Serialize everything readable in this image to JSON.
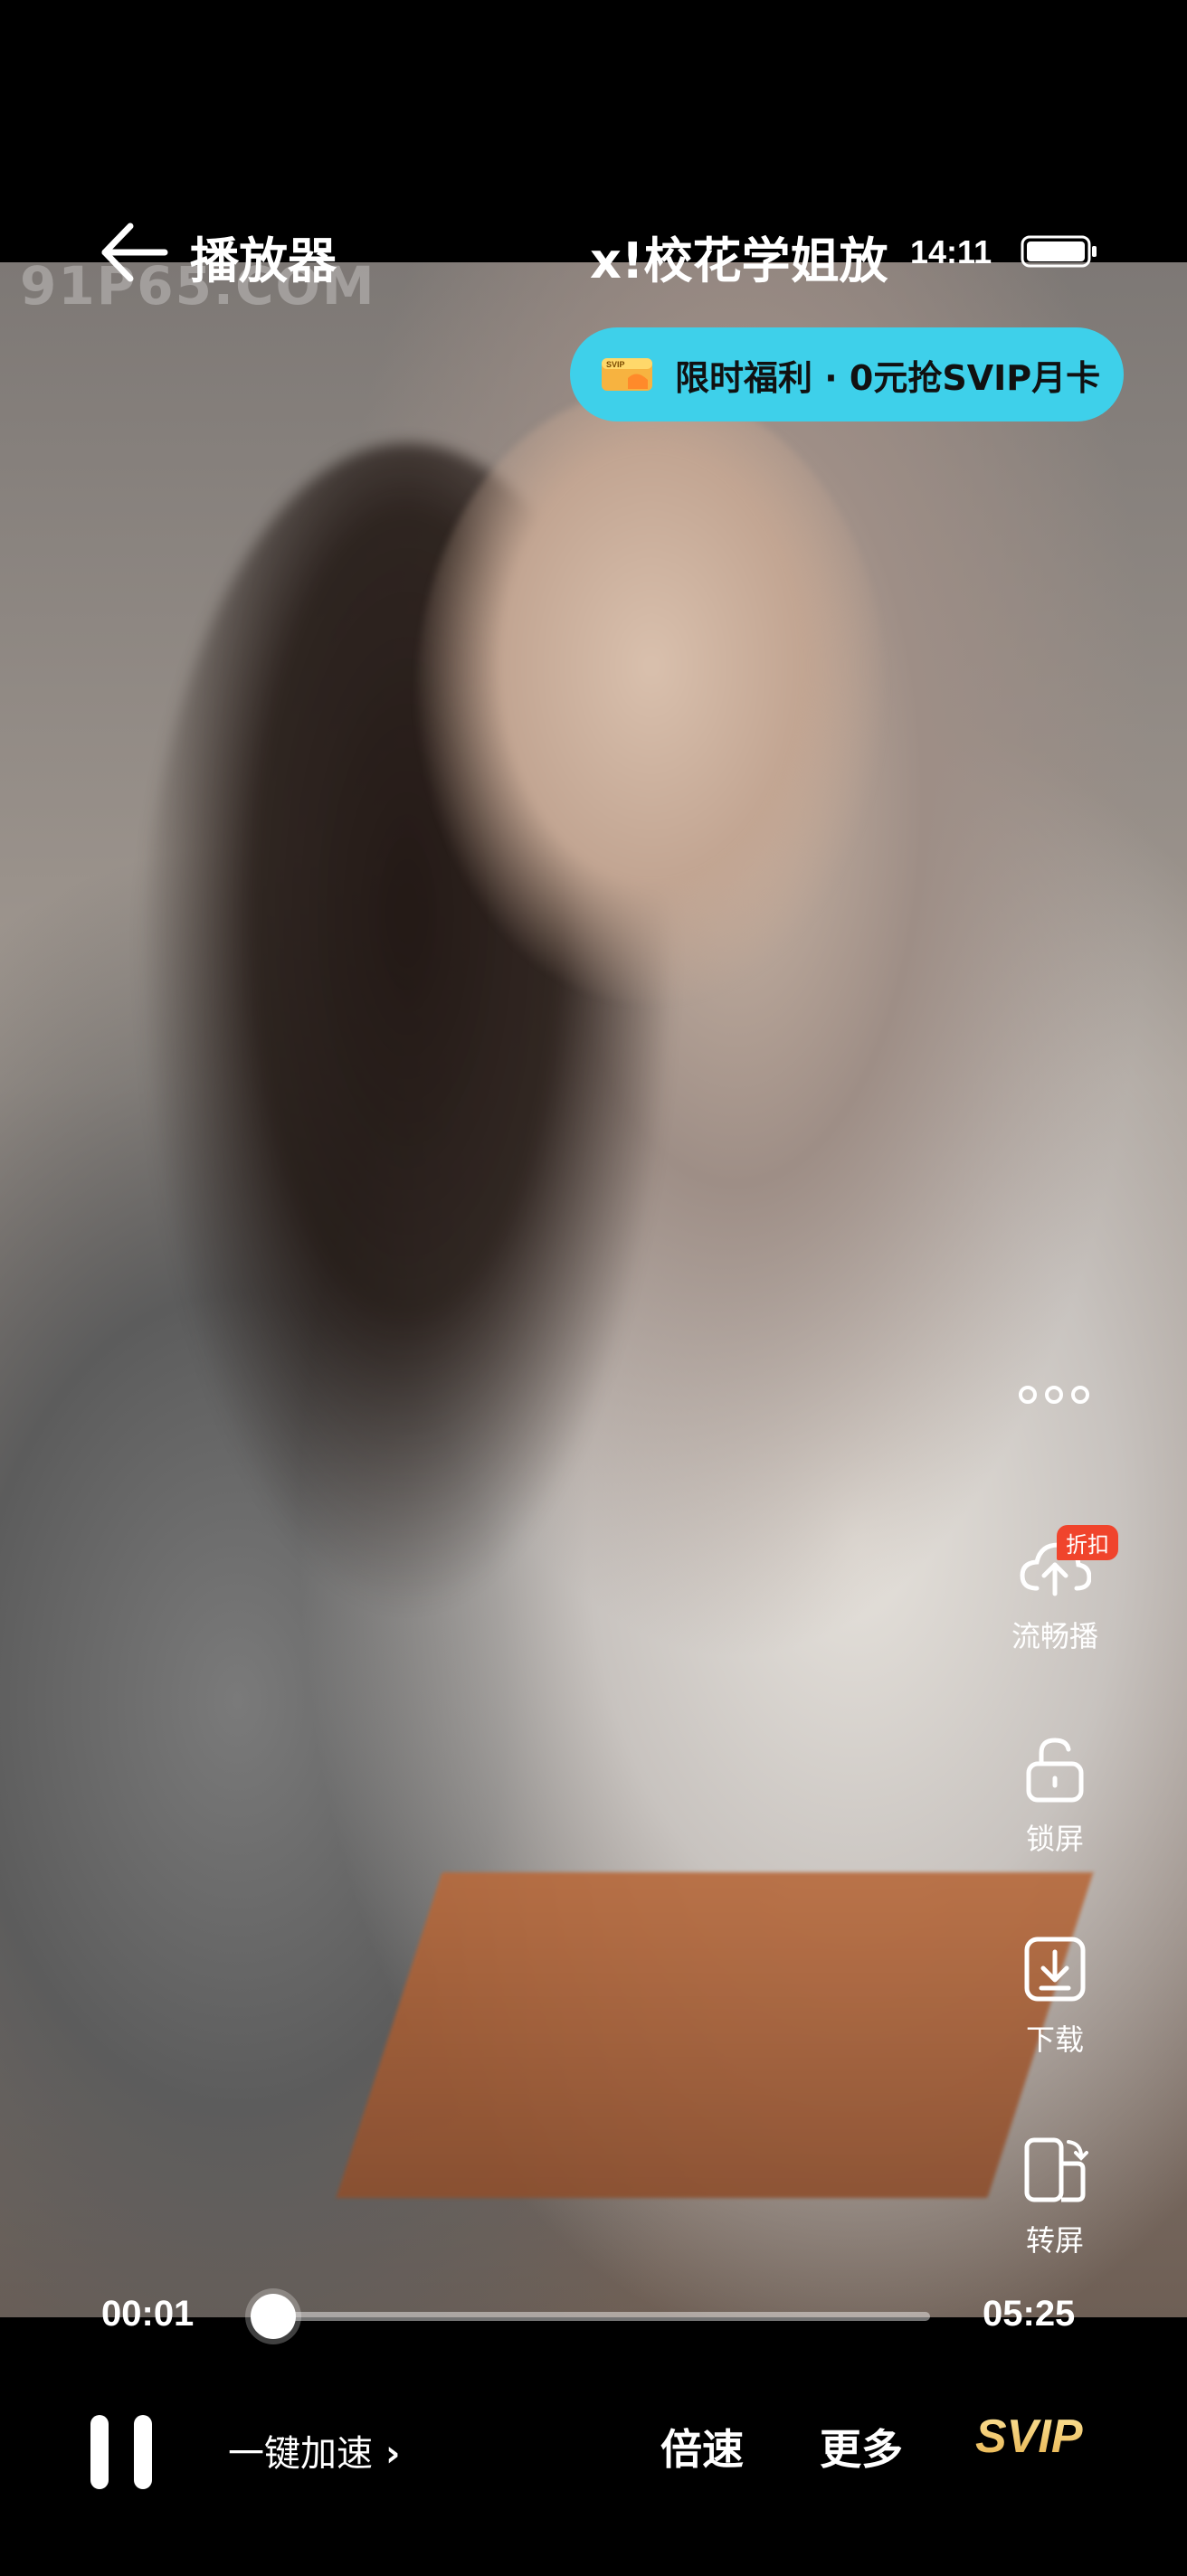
{
  "header": {
    "title_left": "播放器",
    "title_right": "x!校花学姐放",
    "back_icon": "back-arrow-icon"
  },
  "status_bar": {
    "time": "14:11",
    "battery_icon": "battery-icon"
  },
  "video": {
    "watermark": "91P65.COM"
  },
  "promo": {
    "icon": "svip-card-icon",
    "text": "限时福利 · 0元抢SVIP月卡",
    "color": "#3ed0ea"
  },
  "side_controls": {
    "more_icon": "more-dots-icon",
    "smooth_play": {
      "label": "流畅播",
      "badge": "折扣",
      "icon": "cloud-upload-icon"
    },
    "lock_screen": {
      "label": "锁屏",
      "icon": "unlock-icon"
    },
    "download": {
      "label": "下载",
      "icon": "download-icon"
    },
    "rotate": {
      "label": "转屏",
      "icon": "rotate-screen-icon"
    }
  },
  "progress": {
    "current": "00:01",
    "total": "05:25",
    "fraction": 0.003
  },
  "bottom_bar": {
    "pause_icon": "pause-icon",
    "boost_label": "一键加速",
    "boost_chevron": "›",
    "speed_label": "倍速",
    "more_label": "更多",
    "svip_label": "SVIP",
    "svip_color": "#e8b24c"
  }
}
